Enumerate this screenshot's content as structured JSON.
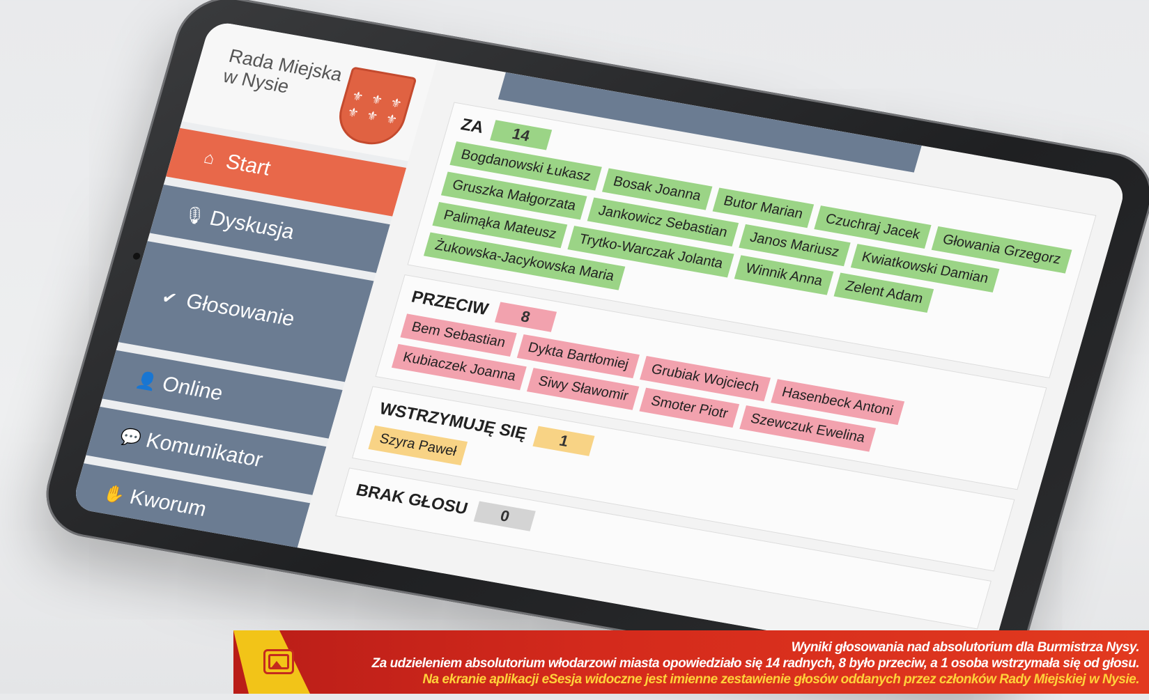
{
  "app": {
    "brand_line1": "Rada Miejska",
    "brand_line2": "w Nysie"
  },
  "sidebar": {
    "items": [
      {
        "label": "Start",
        "icon": "home-icon",
        "glyph": "⌂",
        "active": true
      },
      {
        "label": "Dyskusja",
        "icon": "microphone-icon",
        "glyph": "🎙",
        "active": false
      },
      {
        "label": "Głosowanie",
        "icon": "check-icon",
        "glyph": "✔",
        "active": false
      },
      {
        "label": "Online",
        "icon": "user-icon",
        "glyph": "👤",
        "active": false
      },
      {
        "label": "Komunikator",
        "icon": "chat-icon",
        "glyph": "💬",
        "active": false
      },
      {
        "label": "Kworum",
        "icon": "hand-icon",
        "glyph": "✋",
        "active": false
      }
    ]
  },
  "results": {
    "za": {
      "title": "ZA",
      "count": "14",
      "names": [
        "Bogdanowski Łukasz",
        "Bosak Joanna",
        "Butor Marian",
        "Czuchraj Jacek",
        "Głowania Grzegorz",
        "Gruszka Małgorzata",
        "Jankowicz Sebastian",
        "Janos Mariusz",
        "Kwiatkowski Damian",
        "Palimąka Mateusz",
        "Trytko-Warczak Jolanta",
        "Winnik Anna",
        "Zelent Adam",
        "Żukowska-Jacykowska Maria"
      ]
    },
    "przeciw": {
      "title": "PRZECIW",
      "count": "8",
      "names": [
        "Bem Sebastian",
        "Dykta Bartłomiej",
        "Grubiak Wojciech",
        "Hasenbeck Antoni",
        "Kubiaczek Joanna",
        "Siwy Sławomir",
        "Smoter Piotr",
        "Szewczuk Ewelina"
      ]
    },
    "wstrzymuje": {
      "title": "WSTRZYMUJĘ SIĘ",
      "count": "1",
      "names": [
        "Szyra Paweł"
      ]
    },
    "brak": {
      "title": "BRAK GŁOSU",
      "count": "0"
    }
  },
  "caption": {
    "line1": "Wyniki głosowania nad absolutorium dla Burmistrza Nysy.",
    "line2": "Za udzieleniem absolutorium włodarzowi miasta opowiedziało się 14 radnych, 8 było przeciw, a 1 osoba wstrzymała się od głosu.",
    "line3": "Na ekranie aplikacji eSesja widoczne jest imienne zestawienie głosów oddanych przez członków Rady Miejskiej w Nysie."
  },
  "colors": {
    "za": "#9bd486",
    "przeciw": "#f2a2ae",
    "wstrzymuje": "#f8d385",
    "brak": "#d4d4d4",
    "accent": "#e8684a",
    "menu": "#6b7c92"
  }
}
